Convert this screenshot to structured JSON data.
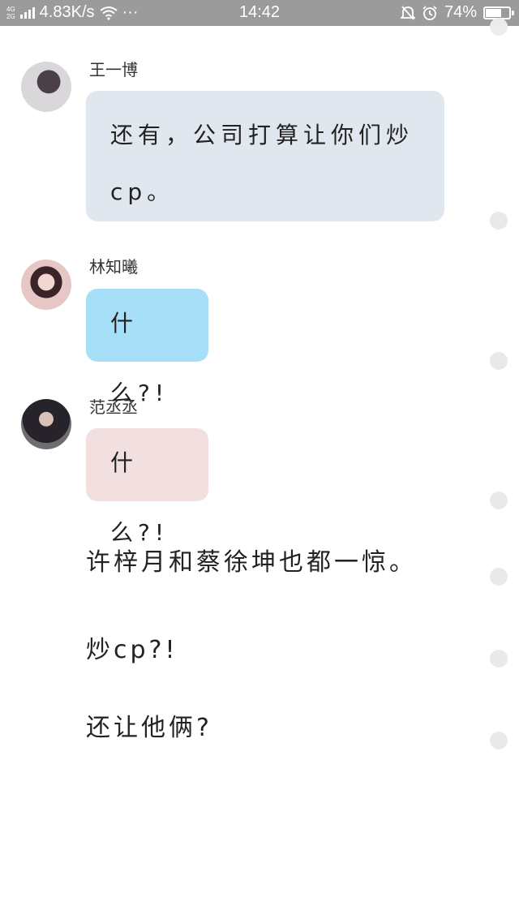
{
  "status_bar": {
    "network_top": "4G",
    "network_bottom": "2G",
    "speed": "4.83K/s",
    "more": "···",
    "time": "14:42",
    "battery": "74%",
    "battery_level": 0.74
  },
  "messages": [
    {
      "sender": "王一博",
      "text": "还有，公司打算让你们炒cp。"
    },
    {
      "sender": "林知曦",
      "text": "什么?!"
    },
    {
      "sender": "范丞丞",
      "text": "什么?!"
    }
  ],
  "narration": [
    "许梓月和蔡徐坤也都一惊。",
    "炒cp?!",
    "还让他俩?"
  ]
}
